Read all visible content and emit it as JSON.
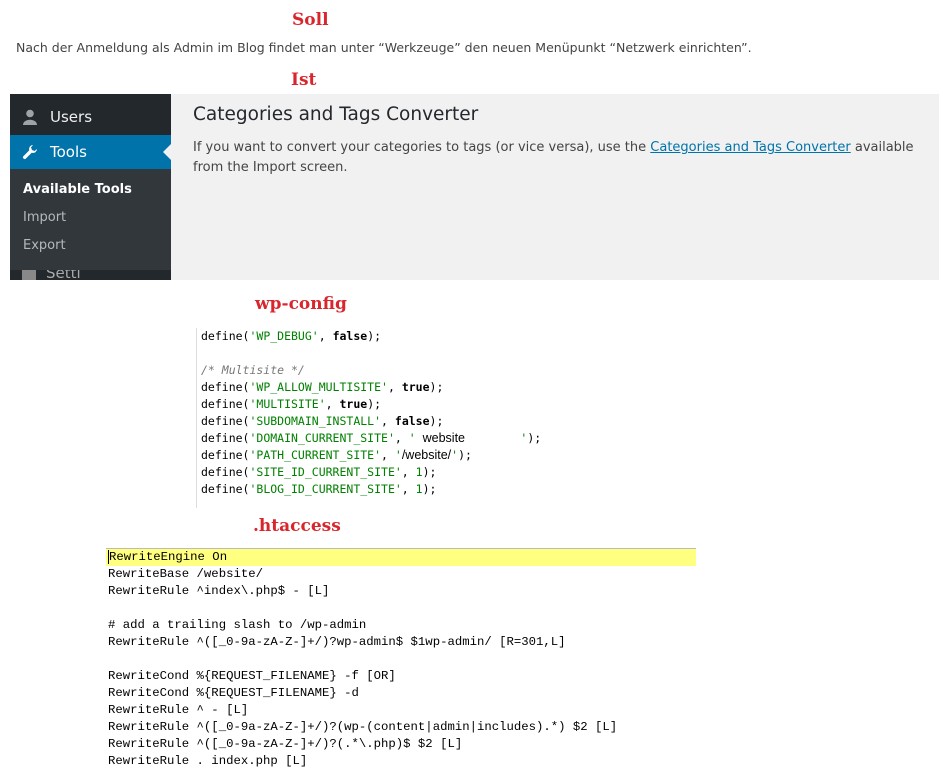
{
  "headings": {
    "soll": "Soll",
    "ist": "Ist",
    "wp_config": "wp-config",
    "htaccess": ".htaccess"
  },
  "intro_text": "Nach der Anmeldung als Admin im Blog findet man unter “Werkzeuge” den neuen Menüpunkt “Netzwerk einrichten”.",
  "wp_admin": {
    "menu": {
      "users": "Users",
      "tools": "Tools",
      "settings_partial": "Setti"
    },
    "submenu": [
      "Available Tools",
      "Import",
      "Export"
    ],
    "main_title": "Categories and Tags Converter",
    "desc_before": "If you want to convert your categories to tags (or vice versa), use the ",
    "desc_link": "Categories and Tags Converter",
    "desc_after": " available from the Import screen.",
    "colors": {
      "sidebar": "#23282d",
      "active": "#0073aa",
      "content_bg": "#f1f1f1"
    }
  },
  "wp_config": {
    "comment": "/* Multisite */",
    "defines": [
      {
        "key": "'WP_DEBUG'",
        "value": "false",
        "kind": "kw"
      },
      {
        "key": "'WP_ALLOW_MULTISITE'",
        "value": "true",
        "kind": "kw"
      },
      {
        "key": "'MULTISITE'",
        "value": "true",
        "kind": "kw"
      },
      {
        "key": "'SUBDOMAIN_INSTALL'",
        "value": "false",
        "kind": "kw"
      },
      {
        "key": "'DOMAIN_CURRENT_SITE'",
        "value": "website",
        "kind": "site"
      },
      {
        "key": "'PATH_CURRENT_SITE'",
        "value": "/website/",
        "kind": "path"
      },
      {
        "key": "'SITE_ID_CURRENT_SITE'",
        "value": "1",
        "kind": "num"
      },
      {
        "key": "'BLOG_ID_CURRENT_SITE'",
        "value": "1",
        "kind": "num"
      }
    ]
  },
  "htaccess_lines": [
    "RewriteEngine On",
    "RewriteBase /website/",
    "RewriteRule ^index\\.php$ - [L]",
    "",
    "# add a trailing slash to /wp-admin",
    "RewriteRule ^([_0-9a-zA-Z-]+/)?wp-admin$ $1wp-admin/ [R=301,L]",
    "",
    "RewriteCond %{REQUEST_FILENAME} -f [OR]",
    "RewriteCond %{REQUEST_FILENAME} -d",
    "RewriteRule ^ - [L]",
    "RewriteRule ^([_0-9a-zA-Z-]+/)?(wp-(content|admin|includes).*) $2 [L]",
    "RewriteRule ^([_0-9a-zA-Z-]+/)?(.*\\.php)$ $2 [L]",
    "RewriteRule . index.php [L]"
  ]
}
